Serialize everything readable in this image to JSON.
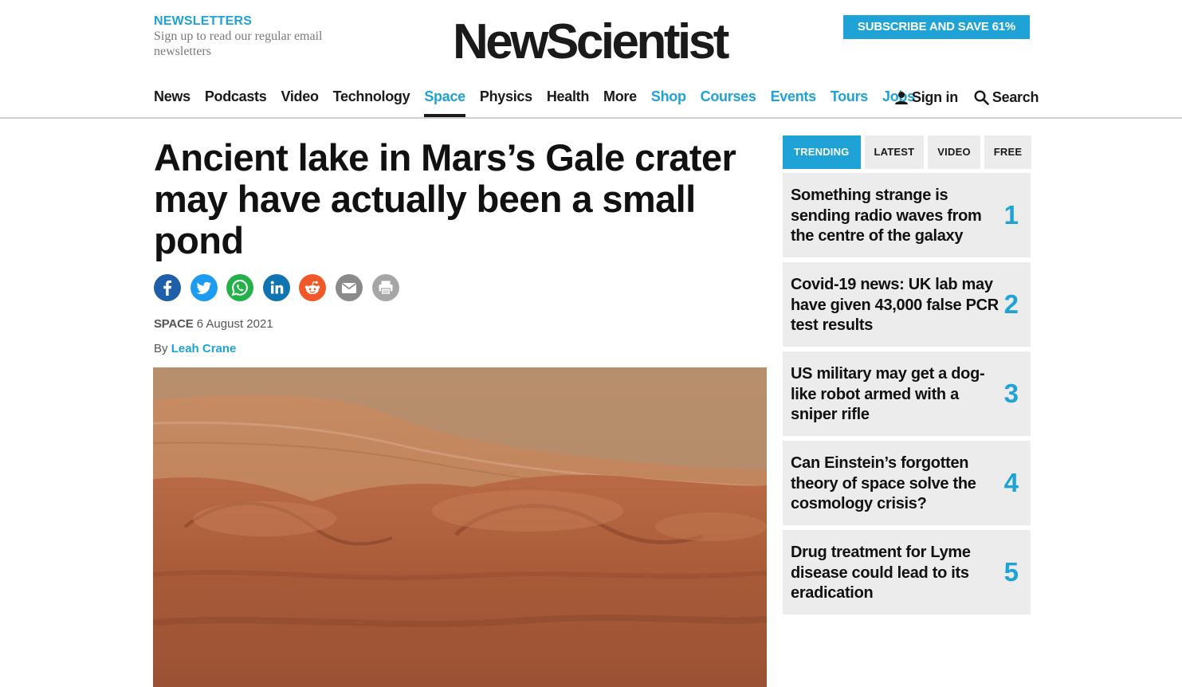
{
  "header": {
    "newsletters_title": "NEWSLETTERS",
    "newsletters_text": "Sign up to read our regular email newsletters",
    "logo": "NewScientist",
    "subscribe_label": "SUBSCRIBE AND SAVE 61%"
  },
  "nav": {
    "items": [
      "News",
      "Podcasts",
      "Video",
      "Technology",
      "Space",
      "Physics",
      "Health",
      "More",
      "Shop",
      "Courses",
      "Events",
      "Tours",
      "Jobs"
    ],
    "active": "Space",
    "sign_in": "Sign in",
    "search": "Search"
  },
  "article": {
    "headline": "Ancient lake in Mars’s Gale crater may have actually been a small pond",
    "section": "SPACE",
    "date": "6 August 2021",
    "by_label": "By",
    "author": "Leah Crane",
    "share_icons": [
      "facebook-icon",
      "twitter-icon",
      "whatsapp-icon",
      "linkedin-icon",
      "reddit-icon",
      "email-icon",
      "print-icon"
    ]
  },
  "sidebar": {
    "tabs": [
      "TRENDING",
      "LATEST",
      "VIDEO",
      "FREE"
    ],
    "active_tab": "TRENDING",
    "trending": [
      {
        "title": "Something strange is sending radio waves from the centre of the galaxy",
        "rank": "1"
      },
      {
        "title": "Covid-19 news: UK lab may have given 43,000 false PCR test results",
        "rank": "2"
      },
      {
        "title": "US military may get a dog-like robot armed with a sniper rifle",
        "rank": "3"
      },
      {
        "title": "Can Einstein’s forgotten theory of space solve the cosmology crisis?",
        "rank": "4"
      },
      {
        "title": "Drug treatment for Lyme disease could lead to its eradication",
        "rank": "5"
      }
    ]
  },
  "colors": {
    "accent": "#1fa3d6",
    "facebook": "#1f5ea8",
    "twitter": "#1d9bf0",
    "whatsapp": "#25b14a",
    "linkedin": "#1074b0",
    "reddit": "#f0582a",
    "email": "#8a8a8a",
    "print": "#a6a6a6"
  }
}
